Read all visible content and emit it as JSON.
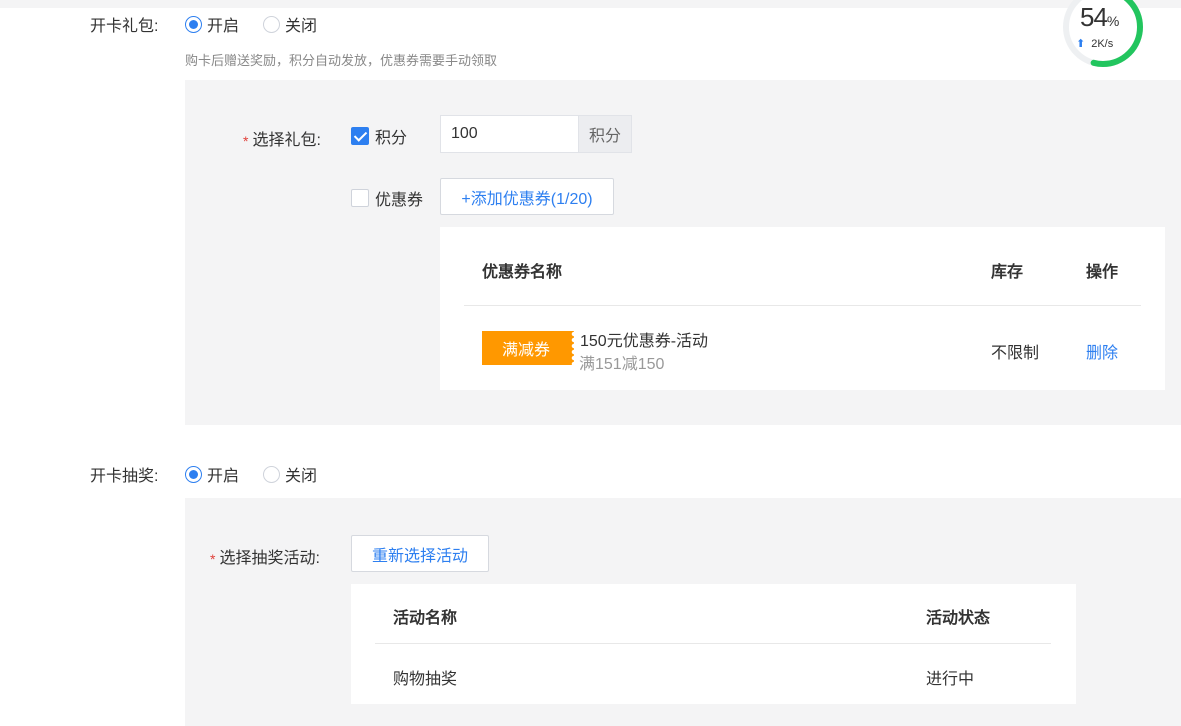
{
  "card_gift": {
    "label": "开卡礼包:",
    "options": [
      {
        "label": "开启",
        "checked": true
      },
      {
        "label": "关闭",
        "checked": false
      }
    ],
    "hint": "购卡后赠送奖励，积分自动发放，优惠券需要手动领取",
    "select_label": "选择礼包:",
    "points": {
      "label": "积分",
      "checked": true,
      "value": "100",
      "unit": "积分"
    },
    "coupon": {
      "label": "优惠券",
      "checked": false,
      "add_button": "+添加优惠券(1/20)"
    },
    "table": {
      "headers": [
        "优惠券名称",
        "库存",
        "操作"
      ],
      "rows": [
        {
          "tag": "满减券",
          "name": "150元优惠券-活动",
          "desc": "满151减150",
          "stock": "不限制",
          "action": "删除"
        }
      ]
    }
  },
  "card_lottery": {
    "label": "开卡抽奖:",
    "options": [
      {
        "label": "开启",
        "checked": true
      },
      {
        "label": "关闭",
        "checked": false
      }
    ],
    "select_label": "选择抽奖活动:",
    "reselect_button": "重新选择活动",
    "table": {
      "headers": [
        "活动名称",
        "活动状态"
      ],
      "rows": [
        {
          "name": "购物抽奖",
          "status": "进行中"
        }
      ]
    }
  },
  "speed_widget": {
    "percent": "54",
    "percent_sign": "%",
    "speed": "2K/s",
    "progress": 0.54,
    "ring_color": "#22c55e"
  },
  "colors": {
    "primary": "#2d7ff0",
    "coupon_tag": "#ff9800",
    "required": "#e0403a",
    "panel_bg": "#f4f4f5"
  }
}
